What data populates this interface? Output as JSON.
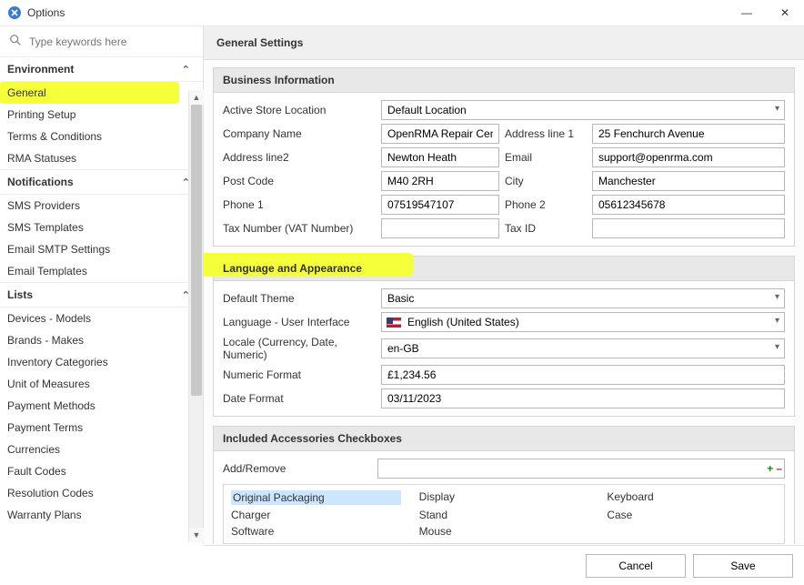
{
  "window": {
    "title": "Options"
  },
  "search": {
    "placeholder": "Type keywords here"
  },
  "sidebar": {
    "sections": [
      {
        "title": "Environment",
        "items": [
          {
            "label": "General",
            "highlight": true
          },
          {
            "label": "Printing Setup"
          },
          {
            "label": "Terms & Conditions"
          },
          {
            "label": "RMA Statuses"
          }
        ]
      },
      {
        "title": "Notifications",
        "items": [
          {
            "label": "SMS Providers"
          },
          {
            "label": "SMS Templates"
          },
          {
            "label": "Email SMTP Settings"
          },
          {
            "label": "Email Templates"
          }
        ]
      },
      {
        "title": "Lists",
        "items": [
          {
            "label": "Devices - Models"
          },
          {
            "label": "Brands - Makes"
          },
          {
            "label": "Inventory Categories"
          },
          {
            "label": "Unit of Measures"
          },
          {
            "label": "Payment Methods"
          },
          {
            "label": "Payment Terms"
          },
          {
            "label": "Currencies"
          },
          {
            "label": "Fault Codes"
          },
          {
            "label": "Resolution Codes"
          },
          {
            "label": "Warranty Plans"
          }
        ]
      }
    ]
  },
  "page": {
    "title": "General Settings"
  },
  "business": {
    "title": "Business Information",
    "labels": {
      "store": "Active Store Location",
      "company": "Company Name",
      "addr1": "Address line 1",
      "addr2": "Address line2",
      "email": "Email",
      "postcode": "Post Code",
      "city": "City",
      "phone1": "Phone 1",
      "phone2": "Phone 2",
      "vat": "Tax Number (VAT Number)",
      "taxid": "Tax ID"
    },
    "values": {
      "store": "Default Location",
      "company": "OpenRMA Repair Centre",
      "addr1": "25 Fenchurch Avenue",
      "addr2": "Newton Heath",
      "email": "support@openrma.com",
      "postcode": "M40 2RH",
      "city": "Manchester",
      "phone1": "07519547107",
      "phone2": "05612345678",
      "vat": "",
      "taxid": ""
    }
  },
  "appearance": {
    "title": "Language and Appearance",
    "labels": {
      "theme": "Default Theme",
      "lang": "Language - User Interface",
      "locale": "Locale (Currency, Date, Numeric)",
      "numfmt": "Numeric Format",
      "datefmt": "Date Format"
    },
    "values": {
      "theme": "Basic",
      "lang": "English (United States)",
      "locale": "en-GB",
      "numfmt": "£1,234.56",
      "datefmt": "03/11/2023"
    }
  },
  "accessories": {
    "title": "Included Accessories Checkboxes",
    "addLabel": "Add/Remove",
    "addValue": "",
    "items": [
      "Original Packaging",
      "Display",
      "Keyboard",
      "Charger",
      "Stand",
      "Case",
      "Software",
      "Mouse"
    ],
    "selected": "Original Packaging"
  },
  "buttons": {
    "cancel": "Cancel",
    "save": "Save"
  }
}
